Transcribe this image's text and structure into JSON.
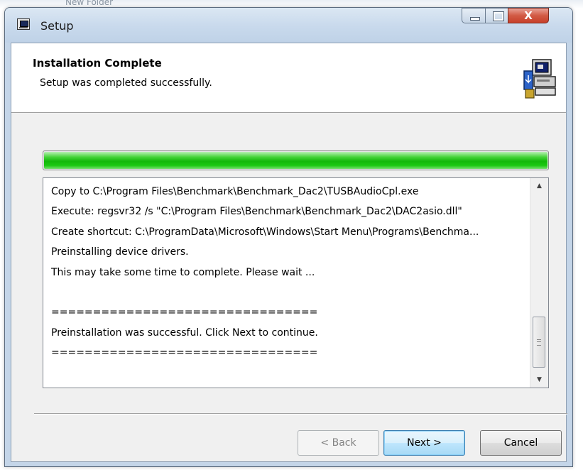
{
  "background": {
    "text": "New Folder"
  },
  "window": {
    "title": "Setup",
    "controls": {
      "minimize": "minimize",
      "maximize": "maximize",
      "close": "X"
    }
  },
  "header": {
    "title": "Installation Complete",
    "subtitle": "Setup was completed successfully."
  },
  "progress": {
    "value_percent": 100,
    "color": "#1bc812"
  },
  "log": {
    "lines": [
      "Copy to C:\\Program Files\\Benchmark\\Benchmark_Dac2\\TUSBAudioCpl.exe",
      "Execute: regsvr32 /s \"C:\\Program Files\\Benchmark\\Benchmark_Dac2\\DAC2asio.dll\"",
      "Create shortcut: C:\\ProgramData\\Microsoft\\Windows\\Start Menu\\Programs\\Benchma...",
      "Preinstalling device drivers.",
      "This may take some time to complete. Please wait ...",
      "",
      "================================",
      "Preinstallation was successful. Click Next to continue.",
      "================================"
    ]
  },
  "buttons": {
    "back": "< Back",
    "next": "Next >",
    "cancel": "Cancel"
  },
  "icons": {
    "title_icon": "setup-window-icon",
    "header_icon": "computer-install-icon"
  }
}
